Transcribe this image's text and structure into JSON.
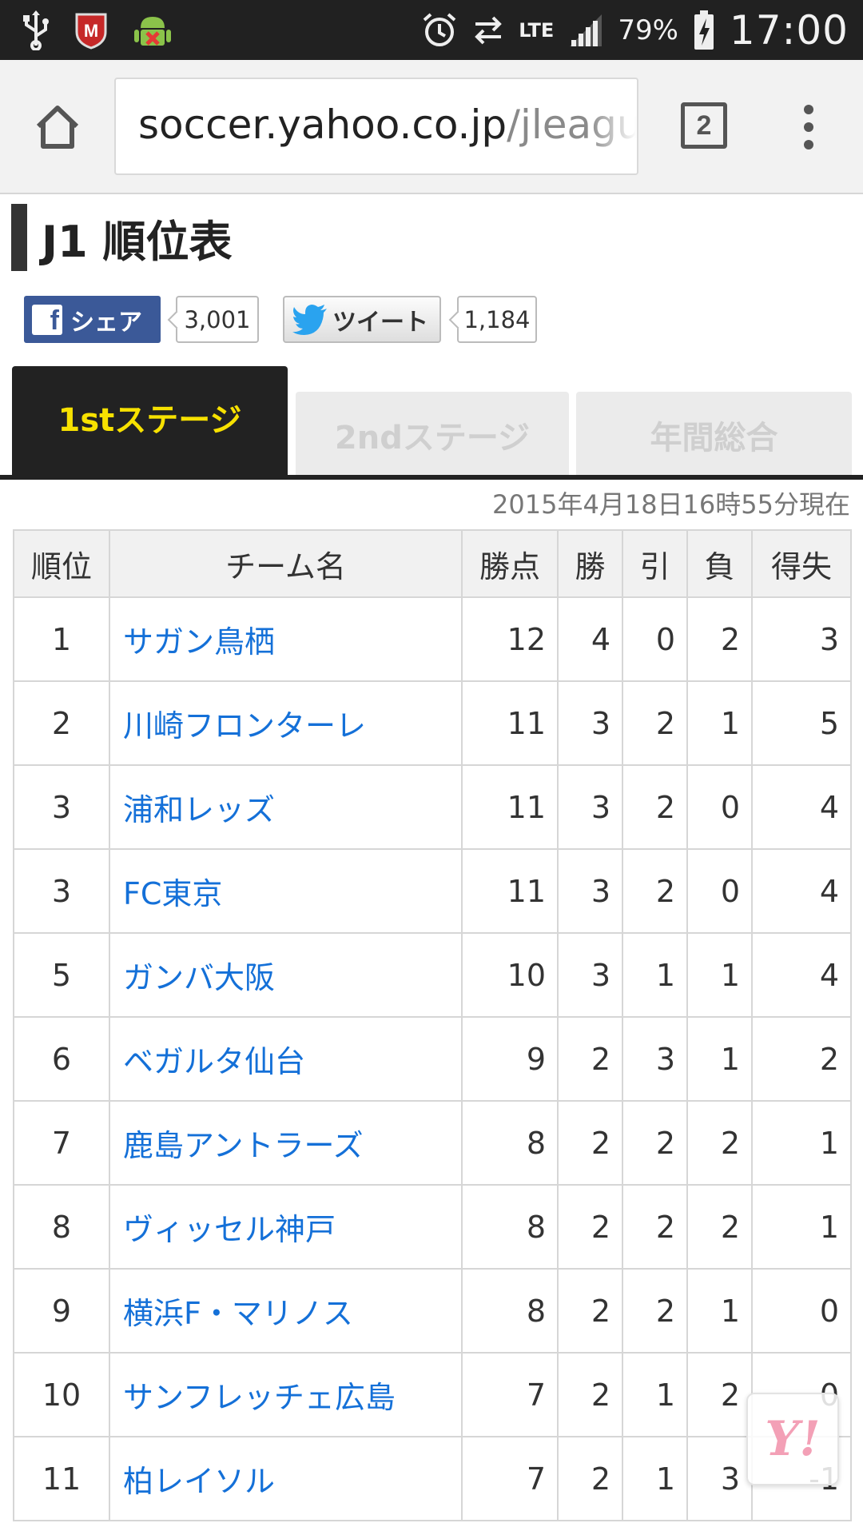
{
  "status_bar": {
    "left_icons": [
      "usb-icon",
      "mcafee-icon",
      "android-debug-icon"
    ],
    "right_icons": [
      "alarm-icon",
      "data-transfer-icon",
      "lte-icon",
      "signal-icon",
      "battery-charging-icon"
    ],
    "network": "LTE",
    "battery": "79%",
    "time": "17:00"
  },
  "browser": {
    "url_host": "soccer.yahoo.co.jp",
    "url_path": "/jleague",
    "tab_count": "2"
  },
  "page": {
    "title": "J1 順位表",
    "social": {
      "facebook_label": "シェア",
      "facebook_count": "3,001",
      "twitter_label": "ツイート",
      "twitter_count": "1,184"
    },
    "stage_tabs": [
      {
        "label": "1stステージ",
        "active": true
      },
      {
        "label": "2ndステージ",
        "active": false
      },
      {
        "label": "年間総合",
        "active": false
      }
    ],
    "updated_at": "2015年4月18日16時55分現在",
    "table": {
      "headers": [
        "順位",
        "チーム名",
        "勝点",
        "勝",
        "引",
        "負",
        "得失"
      ],
      "rows": [
        [
          "1",
          "サガン鳥栖",
          "12",
          "4",
          "0",
          "2",
          "3"
        ],
        [
          "2",
          "川崎フロンターレ",
          "11",
          "3",
          "2",
          "1",
          "5"
        ],
        [
          "3",
          "浦和レッズ",
          "11",
          "3",
          "2",
          "0",
          "4"
        ],
        [
          "3",
          "FC東京",
          "11",
          "3",
          "2",
          "0",
          "4"
        ],
        [
          "5",
          "ガンバ大阪",
          "10",
          "3",
          "1",
          "1",
          "4"
        ],
        [
          "6",
          "ベガルタ仙台",
          "9",
          "2",
          "3",
          "1",
          "2"
        ],
        [
          "7",
          "鹿島アントラーズ",
          "8",
          "2",
          "2",
          "2",
          "1"
        ],
        [
          "8",
          "ヴィッセル神戸",
          "8",
          "2",
          "2",
          "2",
          "1"
        ],
        [
          "9",
          "横浜F・マリノス",
          "8",
          "2",
          "2",
          "1",
          "0"
        ],
        [
          "10",
          "サンフレッチェ広島",
          "7",
          "2",
          "1",
          "2",
          "0"
        ],
        [
          "11",
          "柏レイソル",
          "7",
          "2",
          "1",
          "3",
          "-1"
        ]
      ]
    },
    "floating_button": "Y!"
  }
}
